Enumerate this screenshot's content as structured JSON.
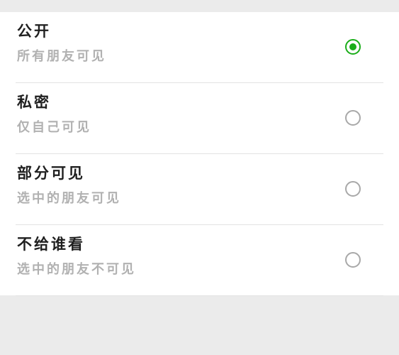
{
  "visibility_options": [
    {
      "title": "公开",
      "subtitle": "所有朋友可见",
      "selected": true
    },
    {
      "title": "私密",
      "subtitle": "仅自己可见",
      "selected": false
    },
    {
      "title": "部分可见",
      "subtitle": "选中的朋友可见",
      "selected": false
    },
    {
      "title": "不给谁看",
      "subtitle": "选中的朋友不可见",
      "selected": false
    }
  ],
  "colors": {
    "accent": "#1aad19",
    "title_text": "#1f1f1f",
    "subtitle_text": "#b1b1b1",
    "radio_border": "#a8a8a8",
    "background": "#ebebeb"
  },
  "icons": {
    "selected": "radio-checked-icon",
    "unselected": "radio-unchecked-icon"
  }
}
